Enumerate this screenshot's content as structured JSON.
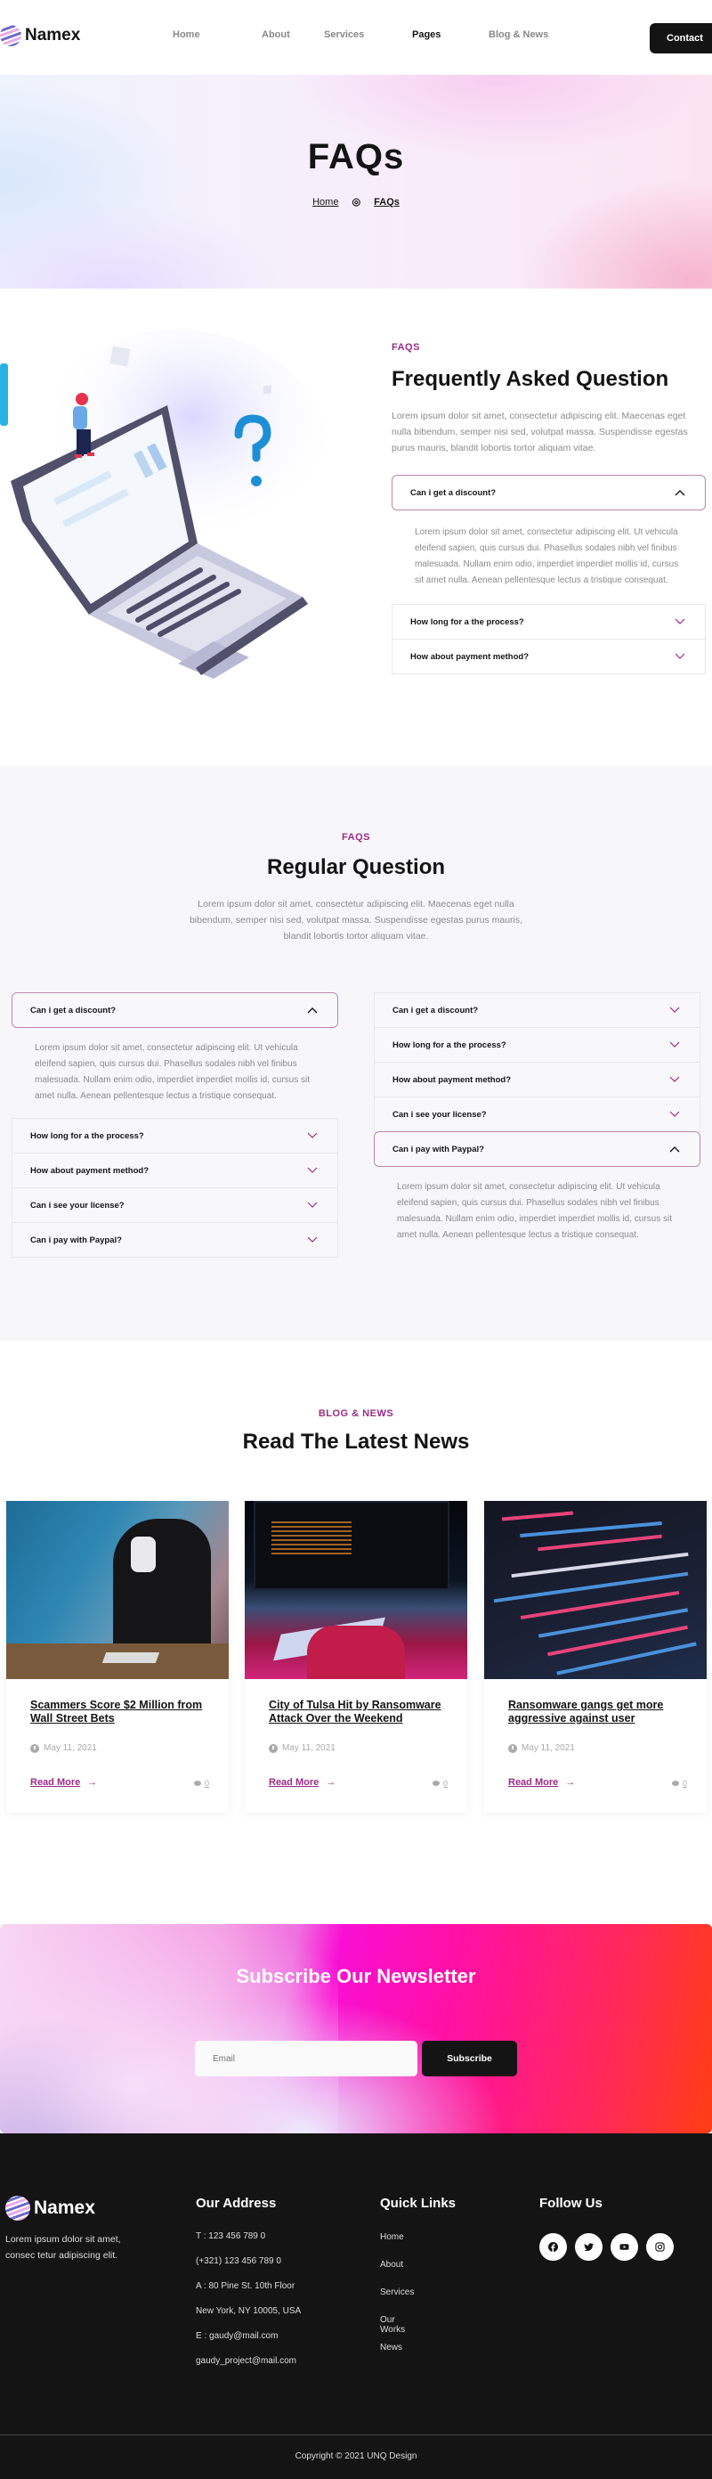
{
  "header": {
    "brand": "Namex",
    "nav": [
      {
        "label": "Home",
        "active": false
      },
      {
        "label": "About",
        "active": false
      },
      {
        "label": "Services",
        "active": false
      },
      {
        "label": "Pages",
        "active": true
      },
      {
        "label": "Blog & News",
        "active": false
      }
    ],
    "contact_label": "Contact"
  },
  "hero": {
    "title": "FAQs",
    "breadcrumb": {
      "home": "Home",
      "separator_icon": "target-icon",
      "current": "FAQs"
    }
  },
  "faq_section": {
    "eyebrow": "FAQS",
    "title": "Frequently Asked Question",
    "lead": "Lorem ipsum dolor sit amet, consectetur adipiscing elit. Maecenas eget nulla bibendum, semper nisi sed, volutpat massa. Suspendisse egestas purus mauris, blandit lobortis tortor aliquam vitae.",
    "items": [
      {
        "question": "Can i get a discount?",
        "open": true,
        "answer": "Lorem ipsum dolor sit amet, consectetur adipiscing elit. Ut vehicula eleifend sapien, quis cursus dui. Phasellus sodales nibh vel finibus malesuada. Nullam enim odio, imperdiet imperdiet mollis id, cursus sit amet nulla. Aenean pellentesque lectus a tristique consequat."
      },
      {
        "question": "How long for a the process?",
        "open": false
      },
      {
        "question": "How about payment method?",
        "open": false
      }
    ]
  },
  "regular_section": {
    "eyebrow": "FAQS",
    "title": "Regular Question",
    "lead": "Lorem ipsum dolor sit amet, consectetur adipiscing elit. Maecenas eget nulla bibendum, semper nisi sed, volutpat massa. Suspendisse egestas purus mauris, blandit lobortis tortor aliquam vitae.",
    "left": [
      {
        "question": "Can i get a discount?",
        "open": true,
        "answer": "Lorem ipsum dolor sit amet, consectetur adipiscing elit. Ut vehicula eleifend sapien, quis cursus dui. Phasellus sodales nibh vel finibus malesuada. Nullam enim odio, imperdiet imperdiet mollis id, cursus sit amet nulla. Aenean pellentesque lectus a tristique consequat."
      },
      {
        "question": "How long for a the process?",
        "open": false
      },
      {
        "question": "How about payment method?",
        "open": false
      },
      {
        "question": "Can i see your license?",
        "open": false
      },
      {
        "question": "Can i pay with Paypal?",
        "open": false
      }
    ],
    "right": [
      {
        "question": "Can i get a discount?",
        "open": false
      },
      {
        "question": "How long for a the process?",
        "open": false
      },
      {
        "question": "How about payment method?",
        "open": false
      },
      {
        "question": "Can i see your license?",
        "open": false
      },
      {
        "question": "Can i pay with Paypal?",
        "open": true,
        "answer": "Lorem ipsum dolor sit amet, consectetur adipiscing elit. Ut vehicula eleifend sapien, quis cursus dui. Phasellus sodales nibh vel finibus malesuada. Nullam enim odio, imperdiet imperdiet mollis id, cursus sit amet nulla. Aenean pellentesque lectus a tristique consequat."
      }
    ]
  },
  "news": {
    "eyebrow": "BLOG & NEWS",
    "title": "Read The Latest News",
    "posts": [
      {
        "title": "Scammers Score $2 Million from Wall Street Bets",
        "date": "May 11, 2021",
        "read_more": "Read More",
        "comments": "0",
        "image": "hooded-hacker-with-cash"
      },
      {
        "title": "City of Tulsa Hit by Ransomware Attack Over the Weekend",
        "date": "May 11, 2021",
        "read_more": "Read More",
        "comments": "0",
        "image": "hands-typing-at-computer"
      },
      {
        "title": "Ransomware gangs get more aggressive against user",
        "date": "May 11, 2021",
        "read_more": "Read More",
        "comments": "0",
        "image": "code-on-screen"
      }
    ]
  },
  "newsletter": {
    "title": "Subscribe Our Newsletter",
    "email_placeholder": "Email",
    "email_value": "",
    "button_label": "Subscribe"
  },
  "footer": {
    "brand": "Namex",
    "description": "Lorem ipsum dolor sit amet, consec tetur adipiscing elit.",
    "address_title": "Our Address",
    "address_lines": [
      "T : 123 456 789 0",
      "(+321) 123 456 789 0",
      "A : 80 Pine St. 10th Floor",
      "New York, NY 10005, USA",
      "E : gaudy@mail.com",
      "gaudy_project@mail.com"
    ],
    "links_title": "Quick Links",
    "links": [
      "Home",
      "About",
      "Services",
      "Our Works",
      "News"
    ],
    "follow_title": "Follow Us",
    "social": [
      "facebook-icon",
      "twitter-icon",
      "youtube-icon",
      "instagram-icon"
    ],
    "copyright": "Copyright © 2021 UNQ Design"
  },
  "colors": {
    "accent": "#9c2b86",
    "dark": "#141414",
    "muted": "#8b8b8b",
    "open_border": "#b888ad"
  }
}
